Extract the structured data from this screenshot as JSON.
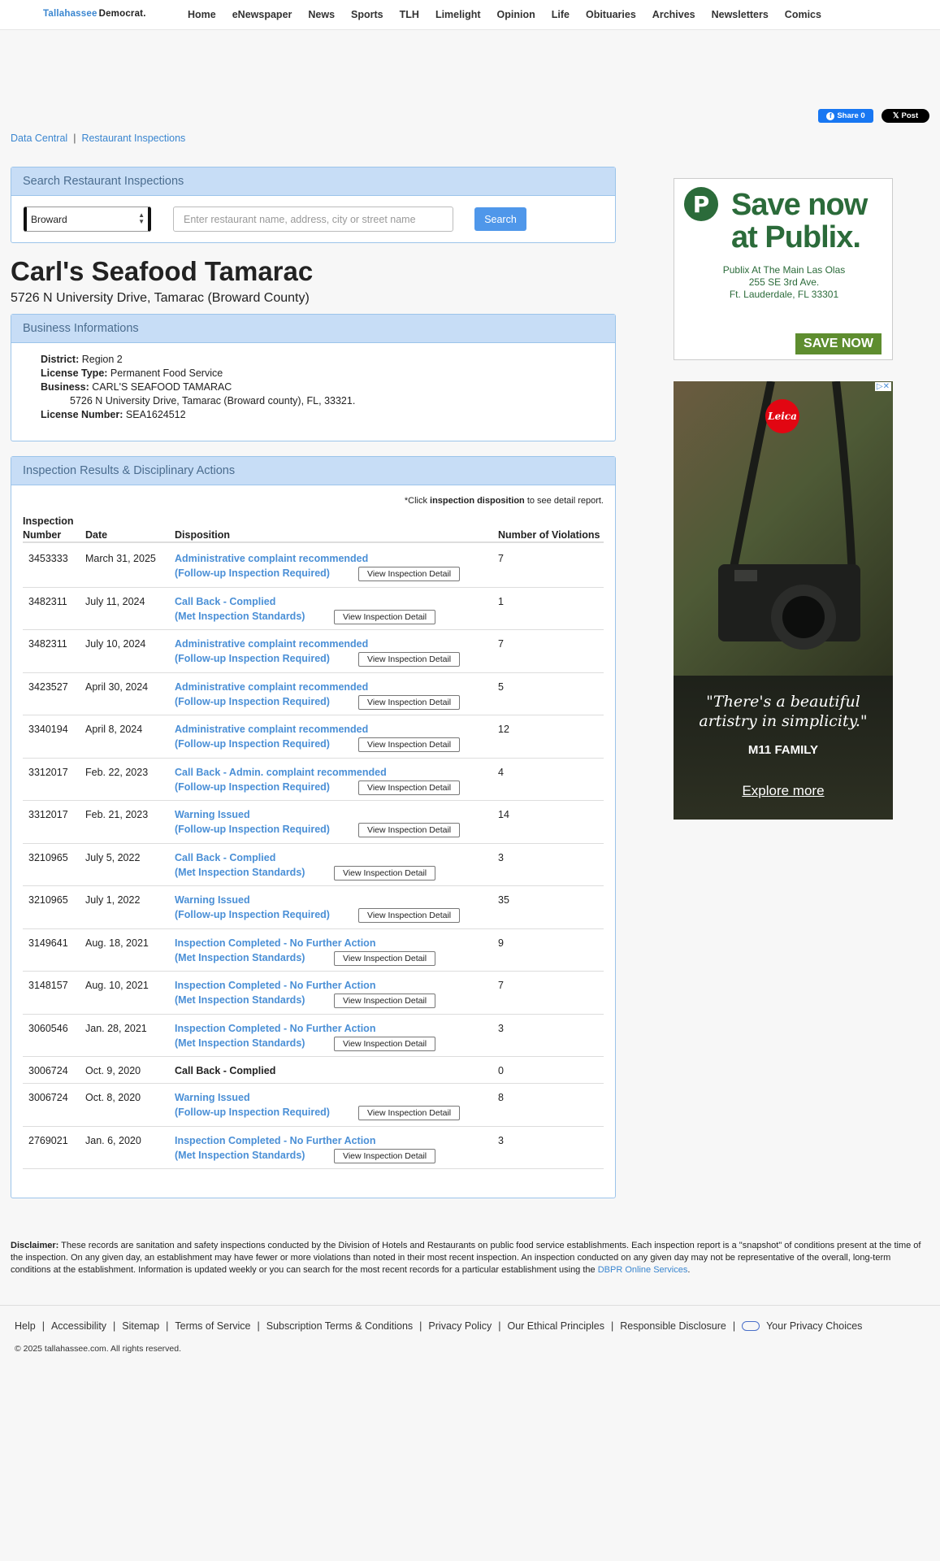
{
  "logo": {
    "part1": "Tallahassee",
    "part2": "Democrat."
  },
  "nav": [
    "Home",
    "eNewspaper",
    "News",
    "Sports",
    "TLH",
    "Limelight",
    "Opinion",
    "Life",
    "Obituaries",
    "Archives",
    "Newsletters",
    "Comics"
  ],
  "share": {
    "facebook": "Share 0",
    "x": "Post"
  },
  "breadcrumb": {
    "item1": "Data Central",
    "item2": "Restaurant Inspections"
  },
  "search": {
    "heading": "Search Restaurant Inspections",
    "county": "Broward",
    "placeholder": "Enter restaurant name, address, city or street name",
    "button": "Search"
  },
  "business": {
    "name": "Carl's Seafood Tamarac",
    "address": "5726 N University Drive, Tamarac (Broward County)"
  },
  "info": {
    "heading": "Business Informations",
    "district_label": "District:",
    "district": "Region 2",
    "license_type_label": "License Type:",
    "license_type": "Permanent Food Service",
    "business_label": "Business:",
    "business": "CARL'S SEAFOOD TAMARAC",
    "business_address": "5726 N University Drive, Tamarac (Broward county), FL, 33321.",
    "license_number_label": "License Number:",
    "license_number": "SEA1624512"
  },
  "results": {
    "heading": "Inspection Results & Disciplinary Actions",
    "note_pre": "*Click ",
    "note_bold": "inspection disposition",
    "note_post": " to see detail report.",
    "col_number_1": "Inspection",
    "col_number_2": "Number",
    "col_date": "Date",
    "col_disposition": "Disposition",
    "col_violations": "Number of Violations",
    "view_button": "View Inspection Detail",
    "rows": [
      {
        "number": "3453333",
        "date": "March 31, 2025",
        "d1": "Administrative complaint recommended",
        "d2": "(Follow-up Inspection Required)",
        "violations": "7"
      },
      {
        "number": "3482311",
        "date": "July 11, 2024",
        "d1": "Call Back - Complied",
        "d2": "(Met Inspection Standards)",
        "violations": "1"
      },
      {
        "number": "3482311",
        "date": "July 10, 2024",
        "d1": "Administrative complaint recommended",
        "d2": "(Follow-up Inspection Required)",
        "violations": "7"
      },
      {
        "number": "3423527",
        "date": "April 30, 2024",
        "d1": "Administrative complaint recommended",
        "d2": "(Follow-up Inspection Required)",
        "violations": "5"
      },
      {
        "number": "3340194",
        "date": "April 8, 2024",
        "d1": "Administrative complaint recommended",
        "d2": "(Follow-up Inspection Required)",
        "violations": "12"
      },
      {
        "number": "3312017",
        "date": "Feb. 22, 2023",
        "d1": "Call Back - Admin. complaint recommended",
        "d2": "(Follow-up Inspection Required)",
        "violations": "4"
      },
      {
        "number": "3312017",
        "date": "Feb. 21, 2023",
        "d1": "Warning Issued",
        "d2": "(Follow-up Inspection Required)",
        "violations": "14"
      },
      {
        "number": "3210965",
        "date": "July 5, 2022",
        "d1": "Call Back - Complied",
        "d2": "(Met Inspection Standards)",
        "violations": "3"
      },
      {
        "number": "3210965",
        "date": "July 1, 2022",
        "d1": "Warning Issued",
        "d2": "(Follow-up Inspection Required)",
        "violations": "35"
      },
      {
        "number": "3149641",
        "date": "Aug. 18, 2021",
        "d1": "Inspection Completed - No Further Action",
        "d2": "(Met Inspection Standards)",
        "violations": "9"
      },
      {
        "number": "3148157",
        "date": "Aug. 10, 2021",
        "d1": "Inspection Completed - No Further Action",
        "d2": "(Met Inspection Standards)",
        "violations": "7"
      },
      {
        "number": "3060546",
        "date": "Jan. 28, 2021",
        "d1": "Inspection Completed - No Further Action",
        "d2": "(Met Inspection Standards)",
        "violations": "3"
      },
      {
        "number": "3006724",
        "date": "Oct. 9, 2020",
        "d1": "Call Back - Complied",
        "d2": "",
        "violations": "0"
      },
      {
        "number": "3006724",
        "date": "Oct. 8, 2020",
        "d1": "Warning Issued",
        "d2": "(Follow-up Inspection Required)",
        "violations": "8"
      },
      {
        "number": "2769021",
        "date": "Jan. 6, 2020",
        "d1": "Inspection Completed - No Further Action",
        "d2": "(Met Inspection Standards)",
        "violations": "3"
      }
    ]
  },
  "ads": {
    "publix": {
      "logo": "P",
      "headline1": "Save now",
      "headline2": "at Publix.",
      "addr1": "Publix At The Main Las Olas",
      "addr2": "255 SE 3rd Ave.",
      "addr3": "Ft. Lauderdale, FL 33301",
      "button": "SAVE NOW"
    },
    "leica": {
      "logo": "Leica",
      "quote1": "\"There's a beautiful",
      "quote2": "artistry in simplicity.\"",
      "family": "M11 FAMILY",
      "cta": "Explore more"
    }
  },
  "disclaimer": {
    "label": "Disclaimer:",
    "text": " These records are sanitation and safety inspections conducted by the Division of Hotels and Restaurants on public food service establishments. Each inspection report is a \"snapshot\" of conditions present at the time of the inspection. On any given day, an establishment may have fewer or more violations than noted in their most recent inspection. An inspection conducted on any given day may not be representative of the overall, long-term conditions at the establishment. Information is updated weekly or you can search for the most recent records for a particular establishment using the ",
    "link": "DBPR Online Services",
    "end": "."
  },
  "footer": {
    "links": [
      "Help",
      "Accessibility",
      "Sitemap",
      "Terms of Service",
      "Subscription Terms & Conditions",
      "Privacy Policy",
      "Our Ethical Principles",
      "Responsible Disclosure"
    ],
    "privacy_choices": "Your Privacy Choices",
    "copyright": "© 2025 tallahassee.com. All rights reserved."
  },
  "colors": {
    "accent": "#3a86d0",
    "panel_head": "#c7ddf6",
    "search_button": "#4f97ea",
    "publix_green": "#2b6b3a"
  }
}
